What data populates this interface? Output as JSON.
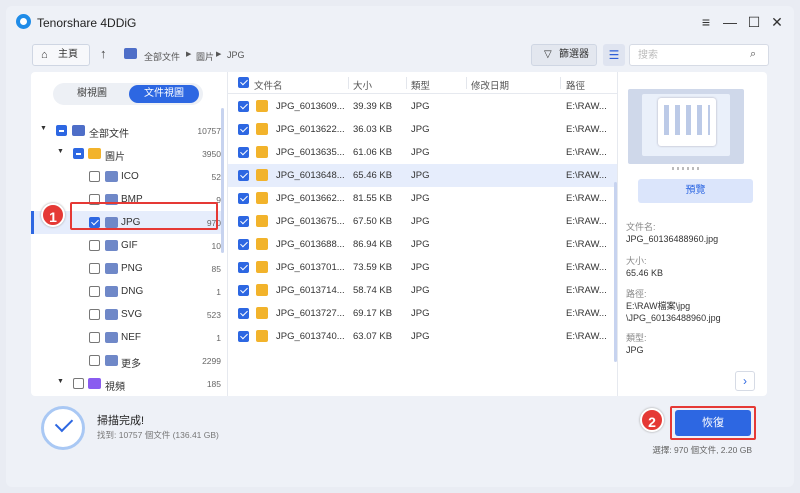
{
  "app": {
    "title": "Tenorshare 4DDiG"
  },
  "toolbar": {
    "home_label": "主頁",
    "breadcrumb": [
      "全部文件",
      "圖片",
      "JPG"
    ],
    "filter_label": "篩選器",
    "search_placeholder": "搜索"
  },
  "view_toggle": {
    "tree": "樹視圖",
    "file": "文件視圖"
  },
  "tree": [
    {
      "name": "全部文件",
      "count": "10757"
    },
    {
      "name": "圖片",
      "count": "3950"
    },
    {
      "name": "ICO",
      "count": "52"
    },
    {
      "name": "BMP",
      "count": "9"
    },
    {
      "name": "JPG",
      "count": "970"
    },
    {
      "name": "GIF",
      "count": "10"
    },
    {
      "name": "PNG",
      "count": "85"
    },
    {
      "name": "DNG",
      "count": "1"
    },
    {
      "name": "SVG",
      "count": "523"
    },
    {
      "name": "NEF",
      "count": "1"
    },
    {
      "name": "更多",
      "count": "2299"
    },
    {
      "name": "視頻",
      "count": "185"
    }
  ],
  "table": {
    "headers": [
      "文件名",
      "大小",
      "類型",
      "修改日期",
      "路徑"
    ],
    "rows": [
      {
        "name": "JPG_6013609...",
        "size": "39.39 KB",
        "type": "JPG",
        "date": "",
        "path": "E:\\RAW..."
      },
      {
        "name": "JPG_6013622...",
        "size": "36.03 KB",
        "type": "JPG",
        "date": "",
        "path": "E:\\RAW..."
      },
      {
        "name": "JPG_6013635...",
        "size": "61.06 KB",
        "type": "JPG",
        "date": "",
        "path": "E:\\RAW..."
      },
      {
        "name": "JPG_6013648...",
        "size": "65.46 KB",
        "type": "JPG",
        "date": "",
        "path": "E:\\RAW..."
      },
      {
        "name": "JPG_6013662...",
        "size": "81.55 KB",
        "type": "JPG",
        "date": "",
        "path": "E:\\RAW..."
      },
      {
        "name": "JPG_6013675...",
        "size": "67.50 KB",
        "type": "JPG",
        "date": "",
        "path": "E:\\RAW..."
      },
      {
        "name": "JPG_6013688...",
        "size": "86.94 KB",
        "type": "JPG",
        "date": "",
        "path": "E:\\RAW..."
      },
      {
        "name": "JPG_6013701...",
        "size": "73.59 KB",
        "type": "JPG",
        "date": "",
        "path": "E:\\RAW..."
      },
      {
        "name": "JPG_6013714...",
        "size": "58.74 KB",
        "type": "JPG",
        "date": "",
        "path": "E:\\RAW..."
      },
      {
        "name": "JPG_6013727...",
        "size": "69.17 KB",
        "type": "JPG",
        "date": "",
        "path": "E:\\RAW..."
      },
      {
        "name": "JPG_6013740...",
        "size": "63.07 KB",
        "type": "JPG",
        "date": "",
        "path": "E:\\RAW..."
      }
    ]
  },
  "preview": {
    "button": "預覽",
    "filename_label": "文件名:",
    "filename": "JPG_60136488960.jpg",
    "size_label": "大小:",
    "size": "65.46 KB",
    "path_label": "路徑:",
    "path": "E:\\RAW檔案\\jpg\n\\JPG_60136488960.jpg",
    "type_label": "類型:",
    "type": "JPG"
  },
  "status": {
    "title": "掃描完成!",
    "found": "找到: 10757 個文件 (136.41 GB)",
    "recover_label": "恢復",
    "selected": "選擇: 970 個文件, 2.20 GB"
  },
  "annotations": {
    "step1": "1",
    "step2": "2"
  },
  "colors": {
    "accent": "#2d67e2",
    "highlight": "#e53935"
  }
}
